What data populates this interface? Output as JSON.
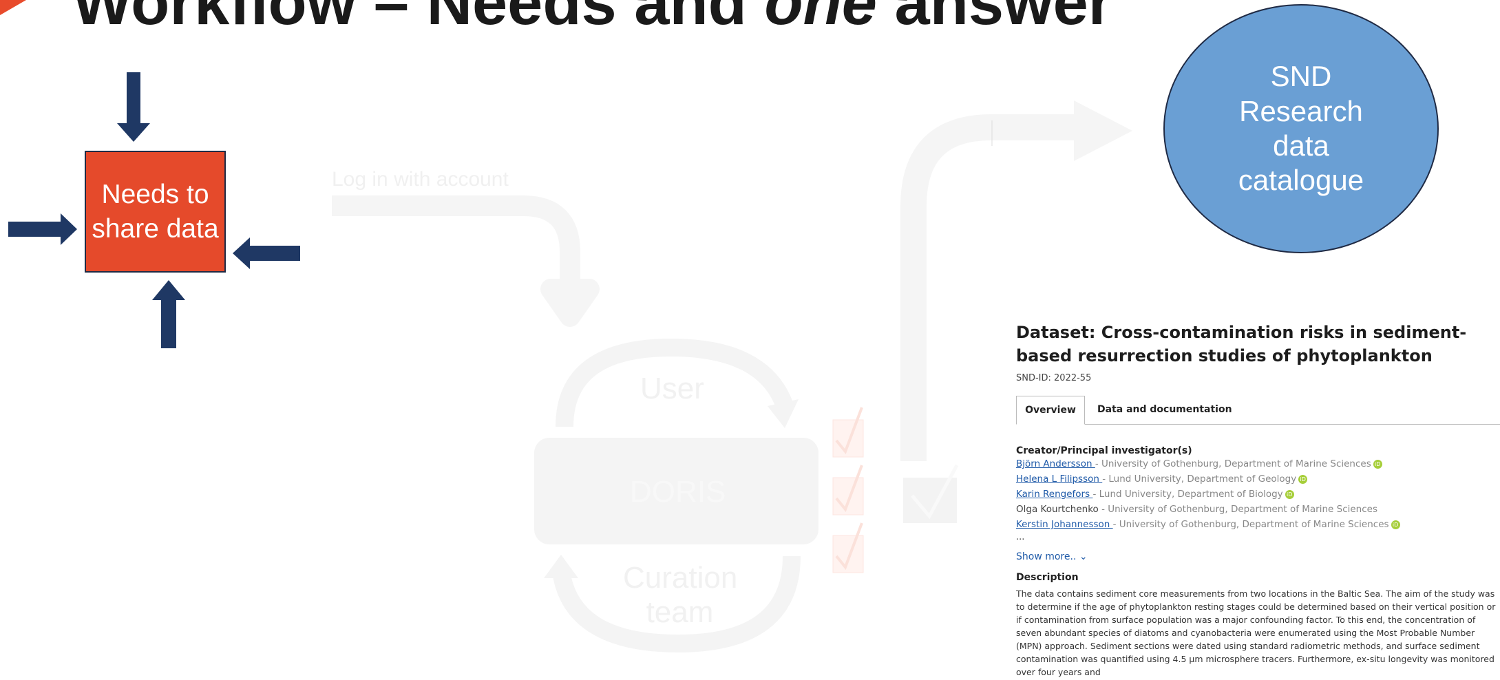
{
  "slide": {
    "title_part1": "Workflow – Needs and ",
    "title_italic": "one",
    "title_part2": " answer"
  },
  "needs_box": {
    "label": "Needs to share data"
  },
  "catalogue_circle": {
    "label": "SND Research data catalogue"
  },
  "background_flow": {
    "login_label": "Log in with account",
    "user_label": "User",
    "doris_label": "DORIS",
    "curation_label": "Curation team"
  },
  "dataset": {
    "title": "Dataset: Cross-contamination risks in sediment-based resurrection studies of phytoplankton",
    "snd_id": "SND-ID: 2022-55",
    "tabs": [
      "Overview",
      "Data and documentation"
    ],
    "creators_heading": "Creator/Principal investigator(s)",
    "creators": [
      {
        "name": "Björn Andersson ",
        "affiliation": "- University of Gothenburg, Department of Marine Sciences",
        "link": true,
        "orcid": true
      },
      {
        "name": "Helena L Filipsson ",
        "affiliation": "- Lund University, Department of Geology",
        "link": true,
        "orcid": true
      },
      {
        "name": "Karin Rengefors ",
        "affiliation": "- Lund University, Department of Biology",
        "link": true,
        "orcid": true
      },
      {
        "name": "Olga Kourtchenko ",
        "affiliation": "- University of Gothenburg, Department of Marine Sciences",
        "link": false,
        "orcid": false
      },
      {
        "name": "Kerstin Johannesson ",
        "affiliation": "- University of Gothenburg, Department of Marine Sciences",
        "link": true,
        "orcid": true
      }
    ],
    "ellipsis": "...",
    "show_more": "Show more.. ⌄",
    "description_heading": "Description",
    "description": "The data contains sediment core measurements from two locations in the Baltic Sea. The aim of the study was to determine if the age of phytoplankton resting stages could be determined based on their vertical position or if contamination from surface population was a major confounding factor. To this end, the concentration of seven abundant species of diatoms and cyanobacteria were enumerated using the Most Probable Number (MPN) approach. Sediment sections were dated using standard radiometric methods, and surface sediment contamination was quantified using 4.5 µm microsphere tracers. Furthermore, ex-situ longevity was monitored over four years and"
  },
  "colors": {
    "needs_box": "#e54a2b",
    "circle": "#6a9fd4",
    "arrows": "#1f3864",
    "link": "#1f5aa8",
    "orcid": "#a6ce39"
  }
}
